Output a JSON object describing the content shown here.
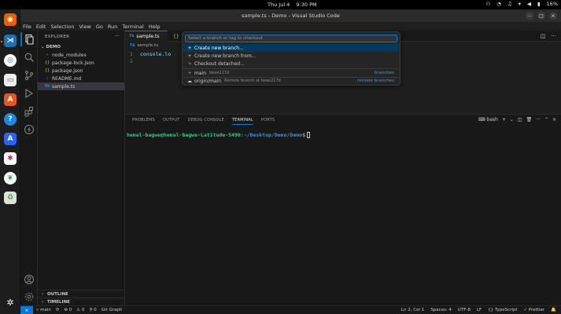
{
  "topbar": {
    "date": "Thu Jul 4",
    "time": "9:30 PM",
    "battery": "16%"
  },
  "window": {
    "title": "sample.ts - Demo - Visual Studio Code"
  },
  "menu": [
    "File",
    "Edit",
    "Selection",
    "View",
    "Go",
    "Run",
    "Terminal",
    "Help"
  ],
  "sidebar": {
    "title": "EXPLORER",
    "more": "···",
    "root": "DEMO",
    "items": [
      {
        "label": "node_modules",
        "icon": "›"
      },
      {
        "label": "package-lock.json",
        "icon": "{}"
      },
      {
        "label": "package.json",
        "icon": "{}"
      },
      {
        "label": "README.md",
        "icon": "i"
      },
      {
        "label": "sample.ts",
        "icon": "TS"
      }
    ],
    "outline": "OUTLINE",
    "timeline": "TIMELINE"
  },
  "tabs": [
    {
      "label": "sample.ts",
      "badge": "TS"
    },
    {
      "label": "",
      "badge": "{}"
    }
  ],
  "breadcrumb": {
    "badge": "TS",
    "file": "sample.ts"
  },
  "code": {
    "line1": "1",
    "line2": "2",
    "text": "console.lo"
  },
  "quickpick": {
    "placeholder": "Select a branch or tag to checkout",
    "items": [
      {
        "icon": "+",
        "label": "Create new branch...",
        "desc": "",
        "right": ""
      },
      {
        "icon": "+",
        "label": "Create new branch from...",
        "desc": "",
        "right": ""
      },
      {
        "icon": "⤷",
        "label": "Checkout detached...",
        "desc": "",
        "right": ""
      },
      {
        "icon": "⑂",
        "label": "main",
        "desc": "beae217d",
        "right": "branches"
      },
      {
        "icon": "☁",
        "label": "origin/main",
        "desc": "Remote branch at beae217d",
        "right": "remote branches"
      }
    ]
  },
  "panel": {
    "tabs": [
      "PROBLEMS",
      "OUTPUT",
      "DEBUG CONSOLE",
      "TERMINAL",
      "PORTS"
    ],
    "shell": "bash",
    "prompt_user": "hemal-bagwe@hemal-bagwe-Latitude-5490",
    "prompt_path": ":~/Desktop/Demo/Demo",
    "prompt_suffix": "$"
  },
  "statusbar": {
    "remote": "⨯",
    "branch": "main",
    "sync": "⟳",
    "errors": "⊗ 0",
    "warnings": "⚠ 0",
    "ports": "⚲ 0",
    "git_graph": "Git Graph",
    "position": "Ln 2, Col 1",
    "spaces": "Spaces: 4",
    "encoding": "UTF-8",
    "eol": "LF",
    "language": "{} TypeScript",
    "prettier": "✓ Prettier",
    "bell": "🔔"
  },
  "colors": {
    "accent": "#0078d4",
    "focused_item": "#04395e",
    "terminal_user": "#23d18b",
    "terminal_path": "#3b8eea"
  }
}
